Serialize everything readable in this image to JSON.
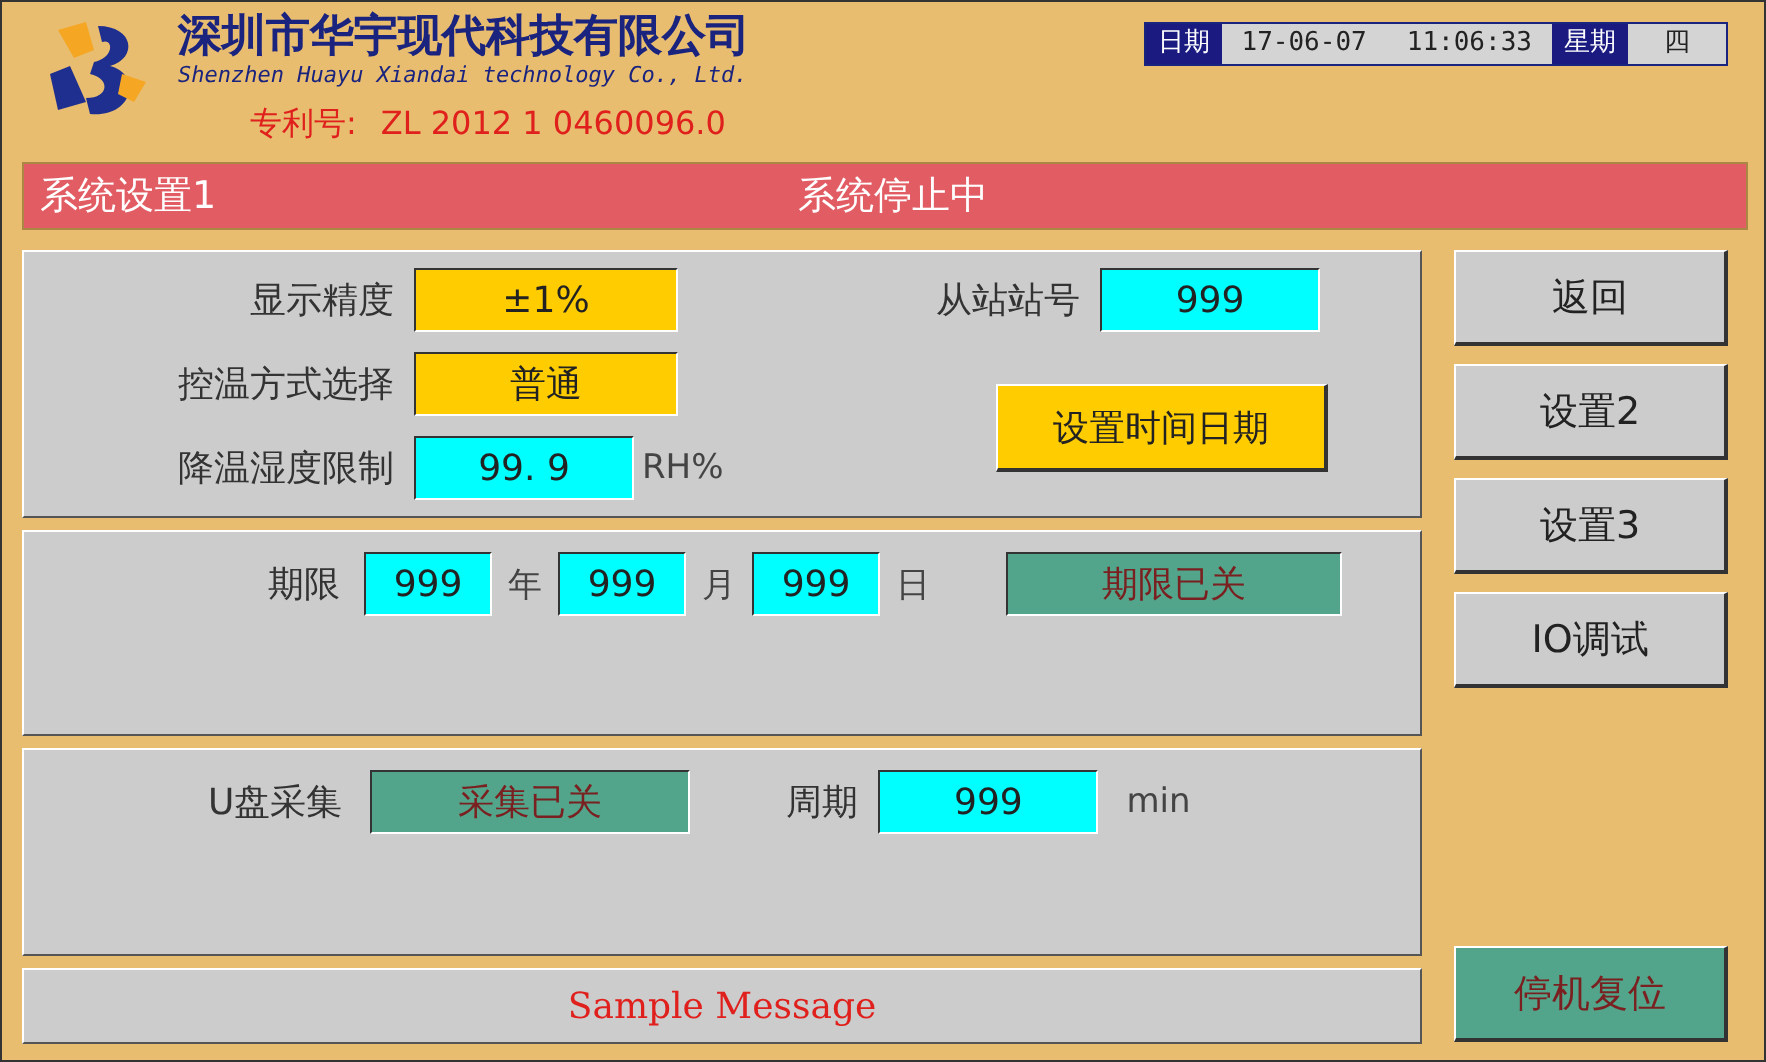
{
  "header": {
    "company_name": "深圳市华宇现代科技有限公司",
    "company_name_en": "Shenzhen Huayu Xiandai technology Co., Ltd.",
    "patent_label": "专利号:",
    "patent_number": "ZL 2012 1 0460096.0"
  },
  "datetime": {
    "date_label": "日期",
    "date": "17-06-07",
    "time": "11:06:33",
    "weekday_label": "星期",
    "weekday": "四"
  },
  "status_bar": {
    "page_title": "系统设置1",
    "status": "系统停止中"
  },
  "settings": {
    "left": [
      {
        "label": "显示精度",
        "value": "±1%",
        "kind": "select"
      },
      {
        "label": "控温方式选择",
        "value": "普通",
        "kind": "select"
      },
      {
        "label": "降温湿度限制",
        "value": "99. 9",
        "kind": "number",
        "unit": "RH%"
      }
    ],
    "slave": {
      "label": "从站站号",
      "value": "999",
      "kind": "number"
    },
    "set_time_button": "设置时间日期"
  },
  "deadline": {
    "label": "期限",
    "parts": [
      {
        "value": "999",
        "unit": "年"
      },
      {
        "value": "999",
        "unit": "月"
      },
      {
        "value": "999",
        "unit": "日"
      }
    ],
    "toggle": {
      "value": "期限已关",
      "kind": "toggle"
    }
  },
  "usb": {
    "label": "U盘采集",
    "toggle": {
      "value": "采集已关",
      "kind": "toggle"
    },
    "period_label": "周期",
    "period": {
      "value": "999",
      "kind": "number"
    },
    "period_unit": "min"
  },
  "message": "Sample Message",
  "nav_buttons": [
    {
      "label": "返回"
    },
    {
      "label": "设置2"
    },
    {
      "label": "设置3"
    },
    {
      "label": "IO调试"
    }
  ],
  "reset_button": {
    "label": "停机复位"
  }
}
